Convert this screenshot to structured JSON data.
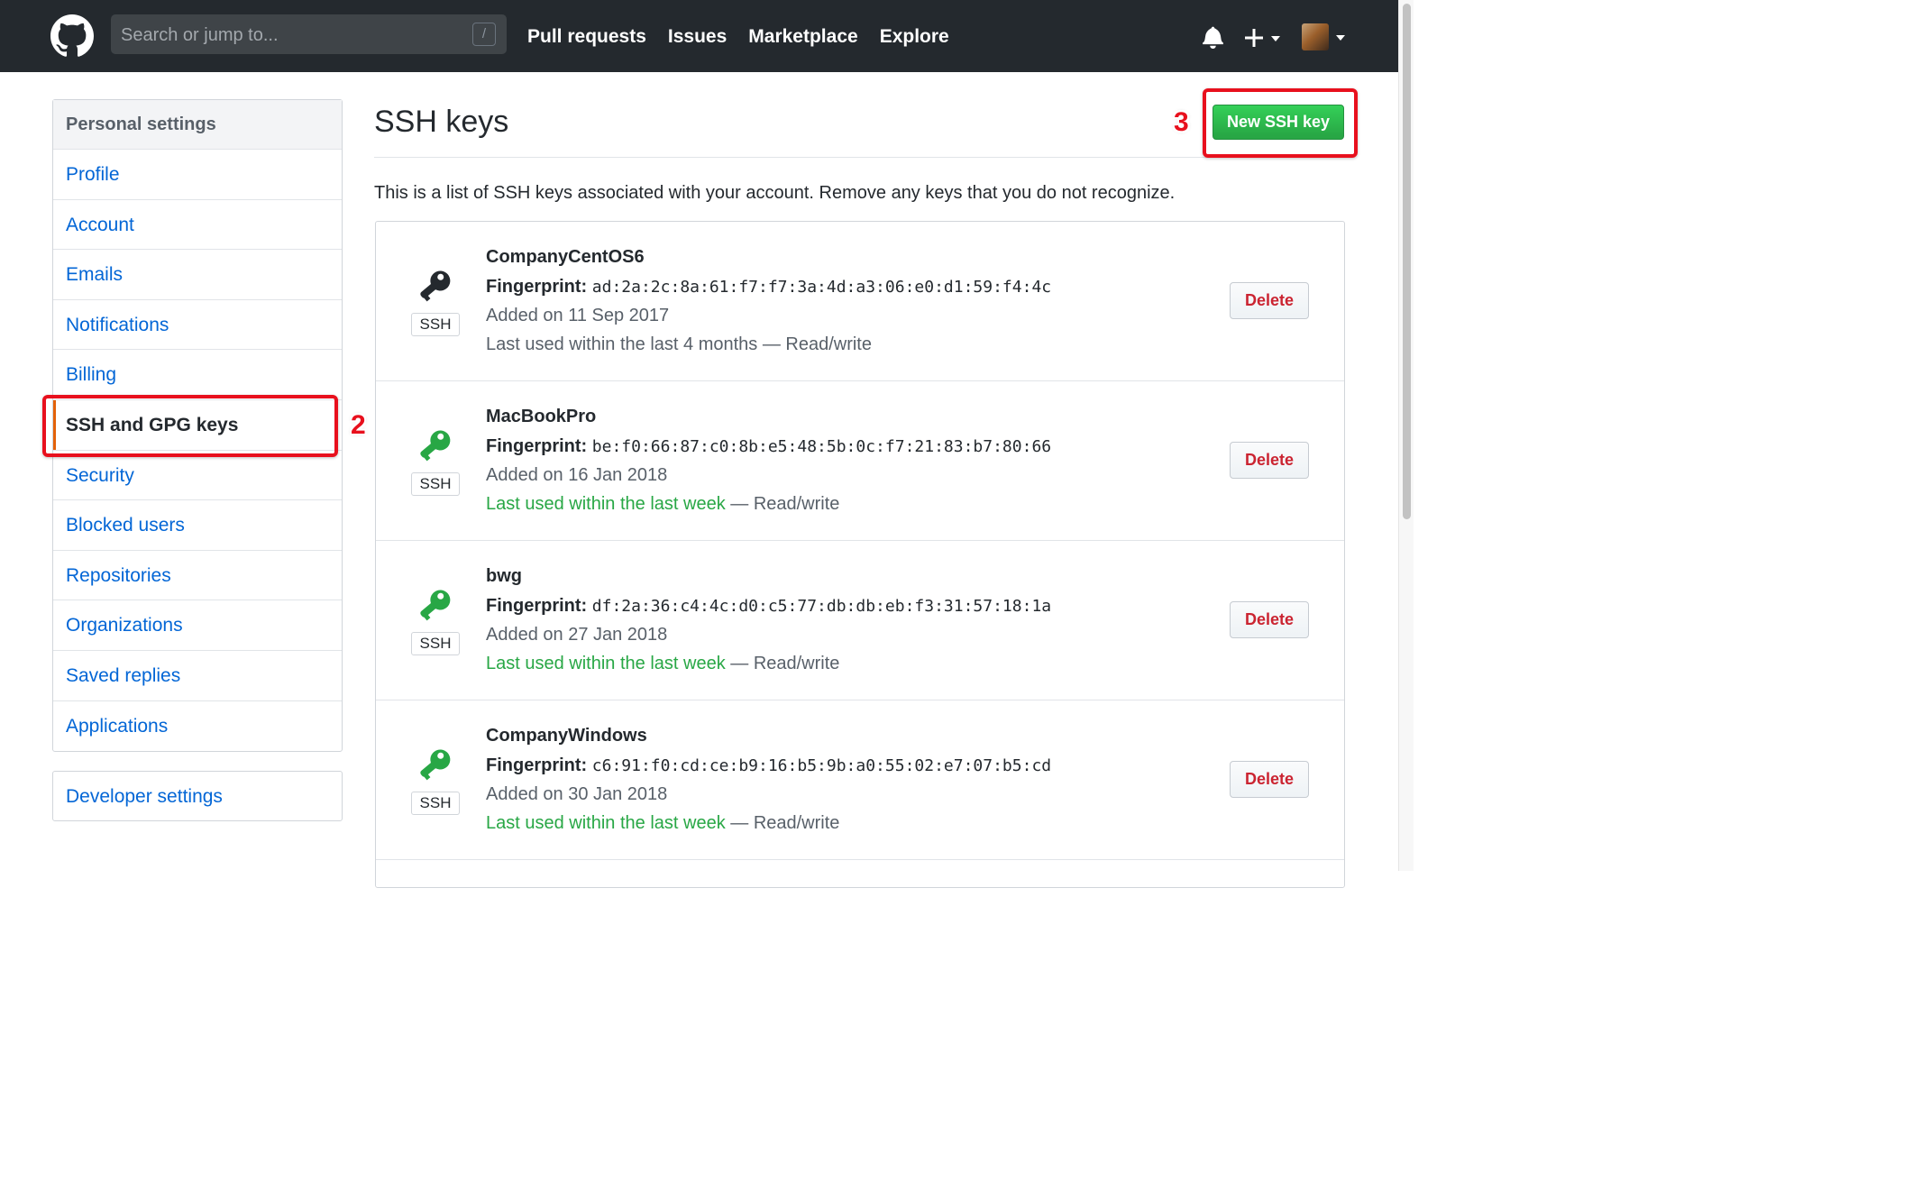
{
  "header": {
    "search_placeholder": "Search or jump to...",
    "search_shortcut": "/",
    "nav": [
      "Pull requests",
      "Issues",
      "Marketplace",
      "Explore"
    ]
  },
  "sidebar": {
    "heading": "Personal settings",
    "items": [
      {
        "label": "Profile"
      },
      {
        "label": "Account"
      },
      {
        "label": "Emails"
      },
      {
        "label": "Notifications"
      },
      {
        "label": "Billing"
      },
      {
        "label": "SSH and GPG keys",
        "selected": true
      },
      {
        "label": "Security"
      },
      {
        "label": "Blocked users"
      },
      {
        "label": "Repositories"
      },
      {
        "label": "Organizations"
      },
      {
        "label": "Saved replies"
      },
      {
        "label": "Applications"
      }
    ],
    "developer_settings": "Developer settings"
  },
  "annotations": {
    "step2": "2",
    "step3": "3"
  },
  "main": {
    "title": "SSH keys",
    "new_key_button": "New SSH key",
    "intro": "This is a list of SSH keys associated with your account. Remove any keys that you do not recognize.",
    "fingerprint_label": "Fingerprint:",
    "ssh_badge": "SSH",
    "delete_label": "Delete",
    "access_suffix": " — Read/write",
    "keys": [
      {
        "title": "CompanyCentOS6",
        "fingerprint": "ad:2a:2c:8a:61:f7:f7:3a:4d:a3:06:e0:d1:59:f4:4c",
        "added": "Added on 11 Sep 2017",
        "last_used": "Last used within the last 4 months",
        "recent": false,
        "icon_color": "#24292e"
      },
      {
        "title": "MacBookPro",
        "fingerprint": "be:f0:66:87:c0:8b:e5:48:5b:0c:f7:21:83:b7:80:66",
        "added": "Added on 16 Jan 2018",
        "last_used": "Last used within the last week",
        "recent": true,
        "icon_color": "#28a745"
      },
      {
        "title": "bwg",
        "fingerprint": "df:2a:36:c4:4c:d0:c5:77:db:db:eb:f3:31:57:18:1a",
        "added": "Added on 27 Jan 2018",
        "last_used": "Last used within the last week",
        "recent": true,
        "icon_color": "#28a745"
      },
      {
        "title": "CompanyWindows",
        "fingerprint": "c6:91:f0:cd:ce:b9:16:b5:9b:a0:55:02:e7:07:b5:cd",
        "added": "Added on 30 Jan 2018",
        "last_used": "Last used within the last week",
        "recent": true,
        "icon_color": "#28a745"
      }
    ]
  },
  "icons": {
    "logo": "github-octocat-icon",
    "notifications": "bell-icon",
    "create": "plus-icon",
    "key": "key-icon"
  }
}
